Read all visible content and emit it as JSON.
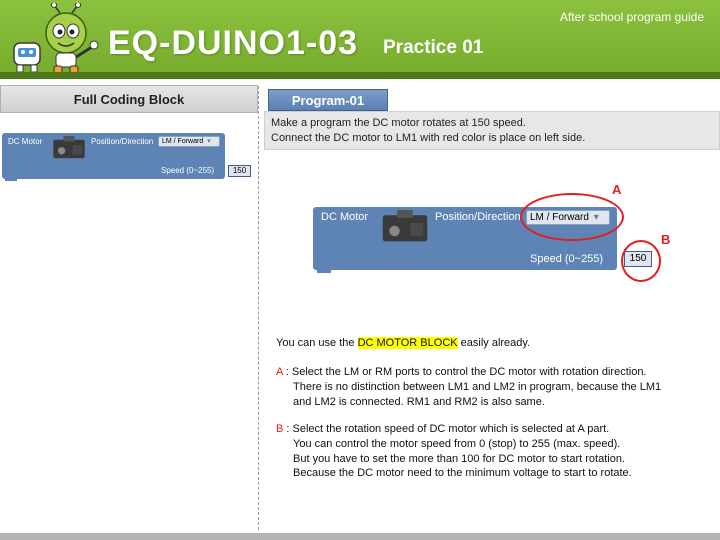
{
  "header": {
    "title": "EQ-DUINO1-03",
    "subtitle": "Practice 01",
    "guide": "After school program guide",
    "colors": {
      "green": "#80b535",
      "dark_green": "#4e7a1c"
    }
  },
  "left_panel": {
    "title": "Full Coding Block",
    "block": {
      "name": "DC Motor",
      "position_label": "Position/Direction",
      "direction_value": "LM / Forward",
      "speed_label": "Speed (0~255)",
      "speed_value": "150"
    }
  },
  "program": {
    "tab_label": "Program-01",
    "description": [
      "Make a program the DC motor rotates at 150 speed.",
      "Connect the DC motor to LM1 with red color is place on left side."
    ],
    "block": {
      "name": "DC Motor",
      "position_label": "Position/Direction",
      "direction_value": "LM / Forward",
      "speed_label": "Speed (0~255)",
      "speed_value": "150"
    },
    "marker_a": "A",
    "marker_b": "B"
  },
  "explanation": {
    "intro_prefix": "You can use the ",
    "intro_highlight": "DC MOTOR BLOCK",
    "intro_suffix": " easily already.",
    "a_label": "A",
    "a_lines": [
      " : Select the LM or RM ports to control the DC motor with rotation direction.",
      "There is no distinction between LM1 and LM2 in program, because the LM1",
      " and LM2 is connected. RM1 and RM2 is also same."
    ],
    "b_label": "B",
    "b_lines": [
      " : Select the rotation speed of DC motor which is selected at A part.",
      "You can control the motor speed from 0 (stop) to 255 (max. speed).",
      "But you have to set the more than 100 for DC motor to start rotation.",
      "Because the DC motor need to the minimum voltage to start to rotate."
    ]
  },
  "colors": {
    "block_blue": "#5d84b4",
    "marker_red": "#e02020",
    "highlight": "#ffff00"
  }
}
